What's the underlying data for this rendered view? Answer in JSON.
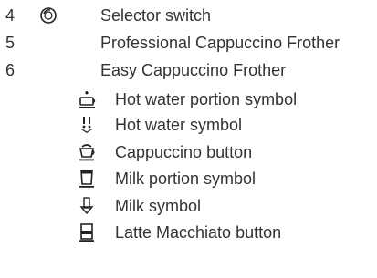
{
  "numbered_items": [
    {
      "number": "4",
      "icon": "selector-switch-icon",
      "label": "Selector switch"
    },
    {
      "number": "5",
      "icon": "",
      "label": "Professional Cappuccino Frother"
    },
    {
      "number": "6",
      "icon": "",
      "label": "Easy Cappuccino Frother"
    }
  ],
  "sub_items": [
    {
      "icon": "hot-water-portion-icon",
      "label": "Hot water portion symbol"
    },
    {
      "icon": "hot-water-icon",
      "label": "Hot water symbol"
    },
    {
      "icon": "cappuccino-icon",
      "label": "Cappuccino button"
    },
    {
      "icon": "milk-portion-icon",
      "label": "Milk portion symbol"
    },
    {
      "icon": "milk-icon",
      "label": "Milk symbol"
    },
    {
      "icon": "latte-macchiato-icon",
      "label": "Latte Macchiato button"
    }
  ],
  "colors": {
    "text": "#333333",
    "icon": "#222222"
  }
}
